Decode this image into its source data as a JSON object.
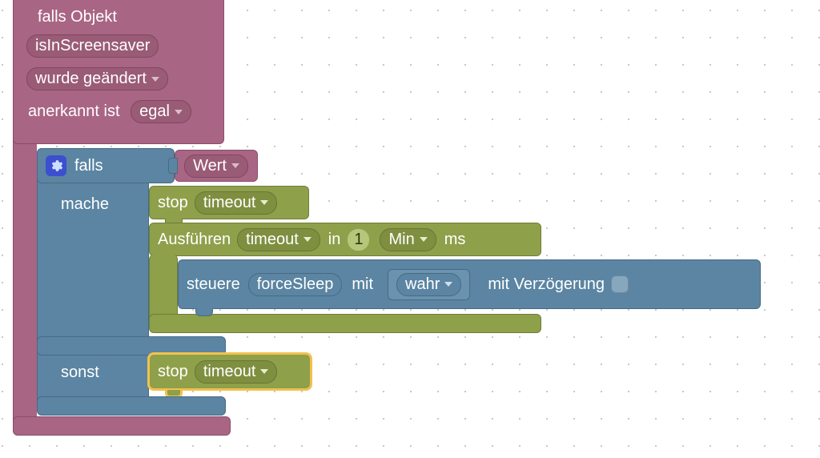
{
  "colors": {
    "plum": "#a96584",
    "plum_dark": "#8a4c6a",
    "steel": "#5b85a2",
    "olive": "#8ea04a",
    "highlight": "#f2c14e"
  },
  "outer": {
    "header": "falls Objekt",
    "objectId": "isInScreensaver",
    "changeDropdown": "wurde geändert",
    "ackLabel": "anerkannt ist",
    "ackValue": "egal"
  },
  "inner_if": {
    "falls": "falls",
    "conditionDropdown": "Wert",
    "mache": "mache",
    "sonst": "sonst"
  },
  "mache": {
    "stop": {
      "label": "stop",
      "timeoutDropdown": "timeout"
    },
    "exec": {
      "label": "Ausführen",
      "nameDropdown": "timeout",
      "inLabel": "in",
      "numValue": "1",
      "unitDropdown": "Min",
      "msLabel": "ms"
    },
    "control": {
      "steuere": "steuere",
      "objectId": "forceSleep",
      "mit": "mit",
      "valueDropdown": "wahr",
      "delayLabel": "mit Verzögerung",
      "delayChecked": false
    }
  },
  "sonst": {
    "stop": {
      "label": "stop",
      "timeoutDropdown": "timeout"
    }
  }
}
